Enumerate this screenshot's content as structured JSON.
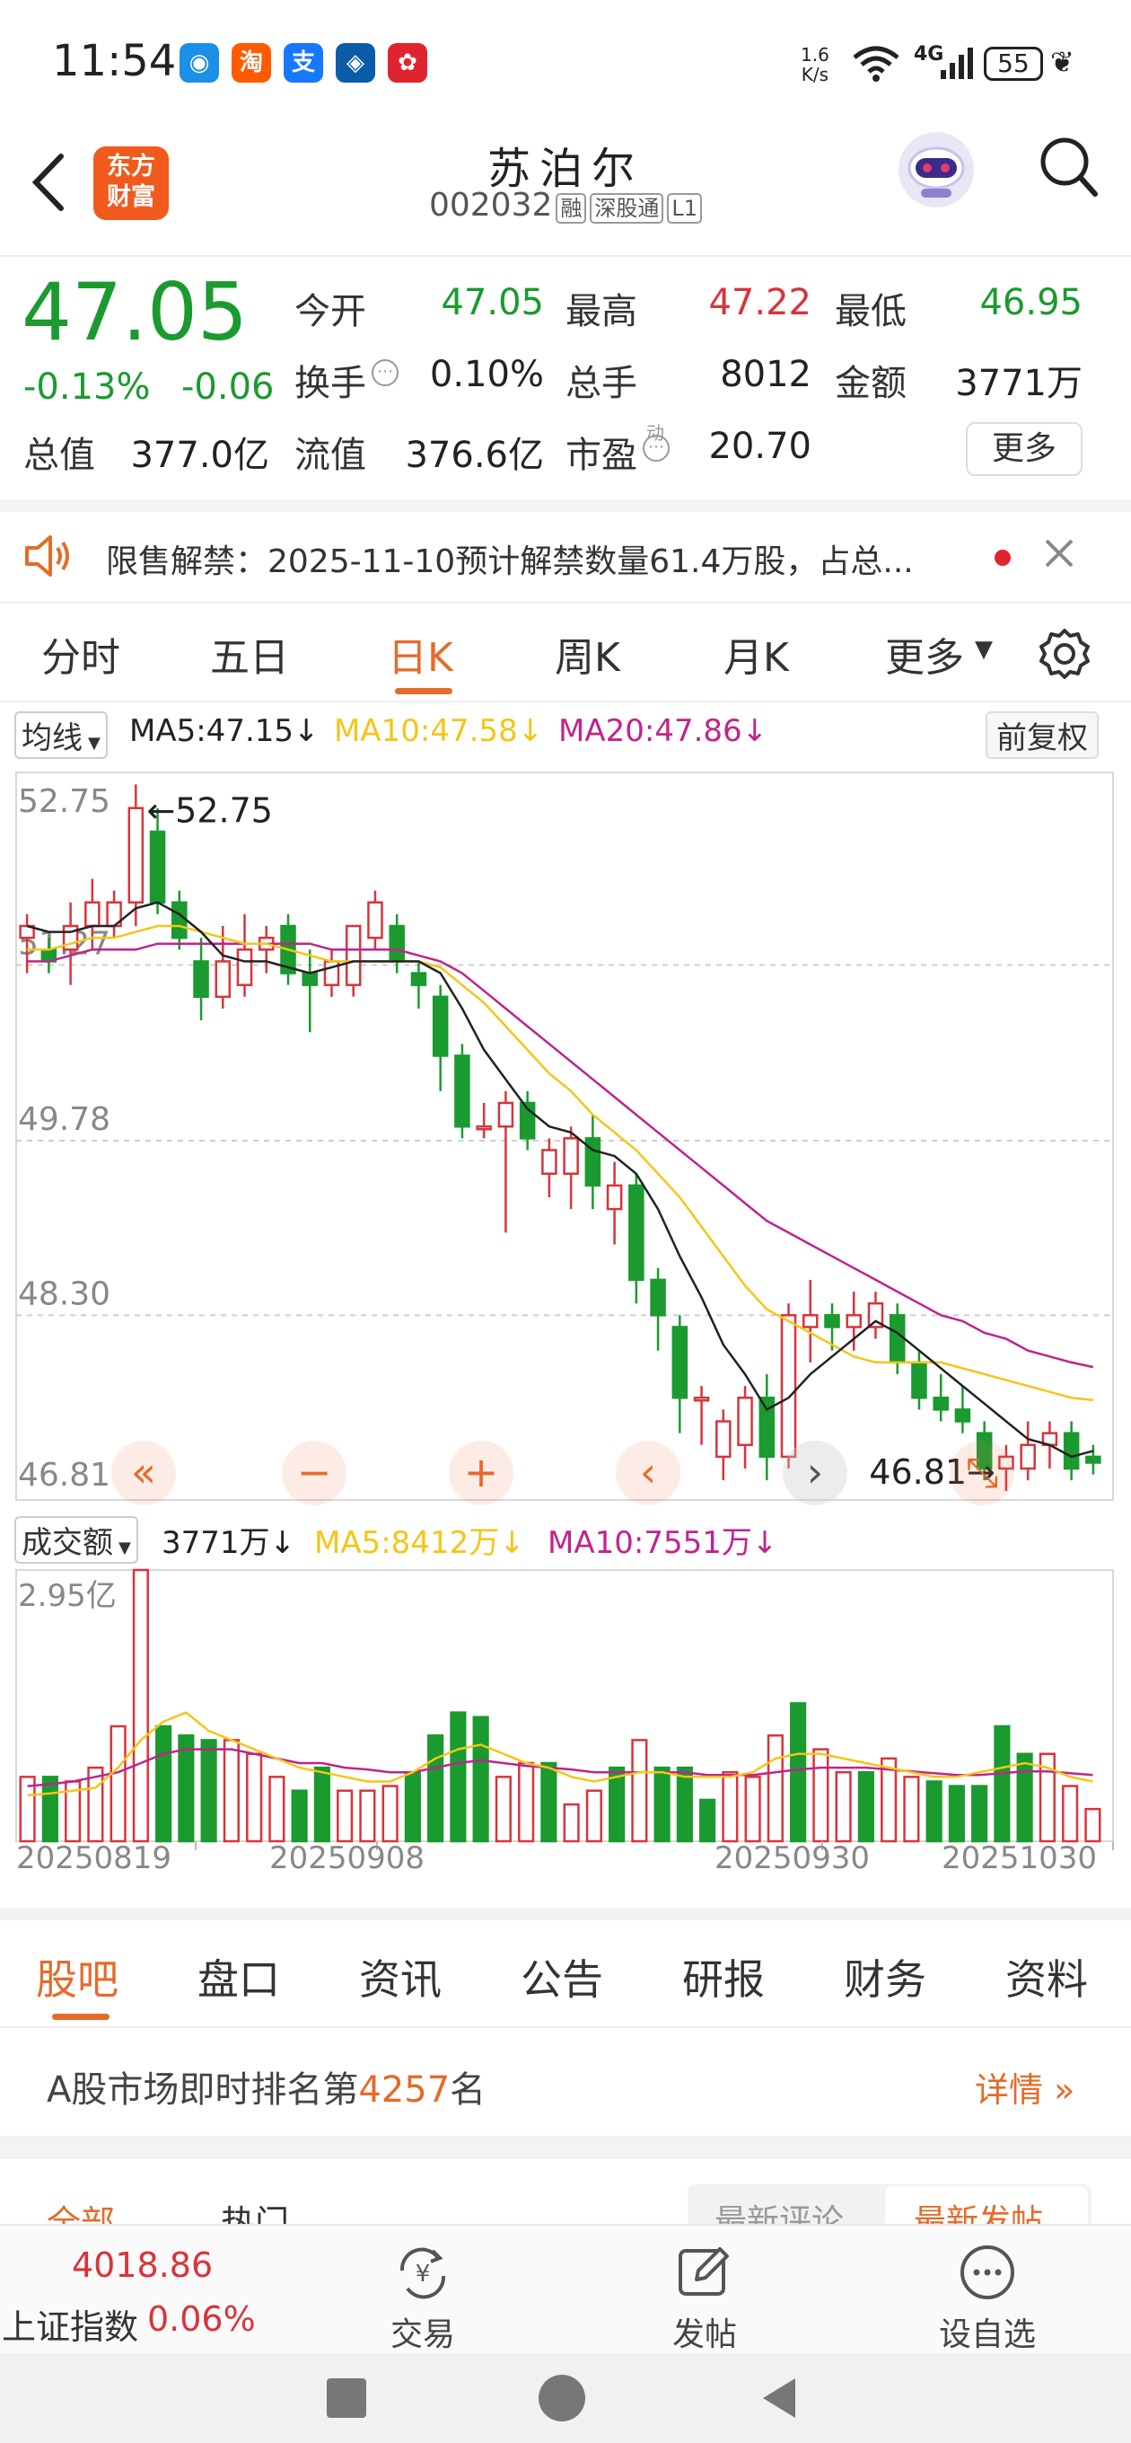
{
  "status": {
    "time": "11:54",
    "net_speed_top": "1.6",
    "net_speed_bottom": "K/s",
    "network": "4G",
    "battery": "55",
    "app_icons": [
      {
        "name": "qq-icon",
        "glyph": "◉",
        "color": "#1c8fe6"
      },
      {
        "name": "taobao-icon",
        "glyph": "淘",
        "color": "#ff5a00"
      },
      {
        "name": "alipay-icon",
        "glyph": "支",
        "color": "#1677ff"
      },
      {
        "name": "ccb-icon",
        "glyph": "◈",
        "color": "#0a5ca8"
      },
      {
        "name": "bank-icon",
        "glyph": "✿",
        "color": "#e0242f"
      }
    ]
  },
  "header": {
    "logo_line1": "东方",
    "logo_line2": "财富",
    "stock_name": "苏泊尔",
    "stock_code": "002032",
    "tags": [
      "融",
      "深股通",
      "L1"
    ]
  },
  "quote": {
    "price": "47.05",
    "change_pct": "-0.13%",
    "change": "-0.06",
    "labels": {
      "open": "今开",
      "high": "最高",
      "low": "最低",
      "turnover_rate": "换手",
      "volume": "总手",
      "amount": "金额",
      "mkt_cap": "总值",
      "float_cap": "流值",
      "pe": "市盈",
      "pe_super": "动",
      "more": "更多"
    },
    "open": "47.05",
    "high": "47.22",
    "low": "46.95",
    "turnover_rate": "0.10%",
    "volume": "8012",
    "amount": "3771万",
    "mkt_cap": "377.0亿",
    "float_cap": "376.6亿",
    "pe": "20.70"
  },
  "notice": {
    "text": "限售解禁：2025-11-10预计解禁数量61.4万股，占总..."
  },
  "period_tabs": {
    "items": [
      "分时",
      "五日",
      "日K",
      "周K",
      "月K",
      "更多"
    ],
    "active": "日K"
  },
  "chart_header": {
    "indicator": "均线",
    "ma5": "MA5:47.15",
    "ma10": "MA10:47.58",
    "ma20": "MA20:47.86",
    "adjust": "前复权",
    "arrow": "↓"
  },
  "volume_header": {
    "indicator": "成交额",
    "vol": "3771万",
    "ma5": "MA5:8412万",
    "ma10": "MA10:7551万",
    "arrow": "↓"
  },
  "colors": {
    "up": "#d8343b",
    "down": "#1a9a2f",
    "ma5": "#222222",
    "ma10": "#f5c518",
    "ma20": "#c0248b",
    "accent": "#e46b2a"
  },
  "chart_data": {
    "type": "candlestick",
    "y_ticks": [
      "52.75",
      "51.27",
      "49.78",
      "48.30",
      "46.81"
    ],
    "ylim": [
      46.81,
      52.75
    ],
    "max_label": "←52.75",
    "min_label": "46.81→",
    "x_ticks": [
      "20250819",
      "20250908",
      "20250930",
      "20251030"
    ],
    "candles": [
      [
        51.5,
        51.7,
        51.2,
        51.6
      ],
      [
        51.4,
        51.5,
        51.2,
        51.3
      ],
      [
        51.4,
        51.8,
        51.1,
        51.6
      ],
      [
        51.6,
        52.0,
        51.4,
        51.8
      ],
      [
        51.6,
        51.9,
        51.5,
        51.8
      ],
      [
        51.8,
        52.8,
        51.6,
        52.6
      ],
      [
        52.4,
        52.6,
        51.7,
        51.8
      ],
      [
        51.8,
        51.9,
        51.4,
        51.5
      ],
      [
        51.3,
        51.5,
        50.8,
        51.0
      ],
      [
        51.0,
        51.6,
        50.9,
        51.3
      ],
      [
        51.1,
        51.7,
        51.0,
        51.4
      ],
      [
        51.4,
        51.6,
        51.2,
        51.5
      ],
      [
        51.6,
        51.7,
        51.1,
        51.2
      ],
      [
        51.2,
        51.4,
        50.7,
        51.1
      ],
      [
        51.1,
        51.4,
        51.0,
        51.3
      ],
      [
        51.1,
        51.6,
        51.0,
        51.6
      ],
      [
        51.5,
        51.9,
        51.4,
        51.8
      ],
      [
        51.6,
        51.7,
        51.2,
        51.3
      ],
      [
        51.2,
        51.3,
        50.9,
        51.1
      ],
      [
        51.0,
        51.1,
        50.2,
        50.5
      ],
      [
        50.5,
        50.6,
        49.8,
        49.9
      ],
      [
        49.9,
        50.1,
        49.8,
        49.9
      ],
      [
        49.9,
        50.2,
        49.0,
        50.1
      ],
      [
        50.1,
        50.2,
        49.7,
        49.8
      ],
      [
        49.5,
        49.8,
        49.3,
        49.7
      ],
      [
        49.5,
        49.9,
        49.2,
        49.8
      ],
      [
        49.8,
        50.0,
        49.2,
        49.4
      ],
      [
        49.2,
        49.6,
        48.9,
        49.4
      ],
      [
        49.4,
        49.5,
        48.4,
        48.6
      ],
      [
        48.6,
        48.7,
        48.0,
        48.3
      ],
      [
        48.2,
        48.3,
        47.3,
        47.6
      ],
      [
        47.6,
        47.7,
        47.2,
        47.6
      ],
      [
        47.1,
        47.5,
        46.9,
        47.4
      ],
      [
        47.2,
        47.7,
        47.0,
        47.6
      ],
      [
        47.6,
        47.8,
        46.9,
        47.1
      ],
      [
        47.1,
        48.4,
        47.0,
        48.3
      ],
      [
        48.2,
        48.6,
        47.9,
        48.3
      ],
      [
        48.3,
        48.4,
        48.0,
        48.2
      ],
      [
        48.2,
        48.5,
        48.0,
        48.3
      ],
      [
        48.2,
        48.5,
        48.1,
        48.4
      ],
      [
        48.3,
        48.4,
        47.8,
        47.9
      ],
      [
        47.9,
        48.0,
        47.5,
        47.6
      ],
      [
        47.6,
        47.8,
        47.4,
        47.5
      ],
      [
        47.5,
        47.7,
        47.3,
        47.4
      ],
      [
        47.3,
        47.4,
        46.9,
        47.0
      ],
      [
        47.0,
        47.2,
        46.81,
        47.1
      ],
      [
        47.0,
        47.4,
        46.9,
        47.2
      ],
      [
        47.2,
        47.4,
        47.0,
        47.3
      ],
      [
        47.3,
        47.4,
        46.9,
        47.0
      ],
      [
        47.1,
        47.2,
        46.95,
        47.05
      ]
    ],
    "ma5": [
      51.6,
      51.55,
      51.55,
      51.6,
      51.6,
      51.75,
      51.8,
      51.7,
      51.55,
      51.35,
      51.3,
      51.3,
      51.25,
      51.2,
      51.25,
      51.3,
      51.3,
      51.3,
      51.3,
      51.2,
      50.9,
      50.55,
      50.3,
      50.05,
      49.9,
      49.85,
      49.7,
      49.65,
      49.5,
      49.2,
      48.8,
      48.45,
      48.05,
      47.8,
      47.5,
      47.6,
      47.8,
      47.95,
      48.1,
      48.25,
      48.15,
      48.0,
      47.85,
      47.7,
      47.55,
      47.4,
      47.25,
      47.2,
      47.1,
      47.15
    ],
    "ma10": [
      51.4,
      51.4,
      51.45,
      51.5,
      51.5,
      51.55,
      51.6,
      51.6,
      51.55,
      51.5,
      51.45,
      51.45,
      51.4,
      51.35,
      51.3,
      51.3,
      51.3,
      51.3,
      51.3,
      51.25,
      51.1,
      50.95,
      50.75,
      50.55,
      50.35,
      50.2,
      50.0,
      49.85,
      49.7,
      49.5,
      49.3,
      49.05,
      48.8,
      48.55,
      48.35,
      48.25,
      48.15,
      48.05,
      47.95,
      47.9,
      47.9,
      47.9,
      47.9,
      47.85,
      47.8,
      47.75,
      47.7,
      47.65,
      47.6,
      47.58
    ],
    "ma20": [
      51.3,
      51.3,
      51.35,
      51.4,
      51.4,
      51.4,
      51.45,
      51.45,
      51.45,
      51.45,
      51.45,
      51.45,
      51.45,
      51.45,
      51.4,
      51.4,
      51.4,
      51.4,
      51.35,
      51.3,
      51.2,
      51.05,
      50.9,
      50.75,
      50.6,
      50.45,
      50.3,
      50.15,
      50.0,
      49.85,
      49.7,
      49.55,
      49.4,
      49.25,
      49.1,
      49.0,
      48.9,
      48.8,
      48.7,
      48.6,
      48.5,
      48.4,
      48.3,
      48.25,
      48.15,
      48.1,
      48.0,
      47.95,
      47.9,
      47.86
    ],
    "volume_max_label": "2.95亿",
    "volume": [
      0.7,
      0.7,
      0.65,
      0.8,
      1.25,
      2.95,
      1.25,
      1.15,
      1.1,
      1.1,
      0.95,
      0.7,
      0.55,
      0.8,
      0.55,
      0.55,
      0.6,
      0.75,
      1.15,
      1.4,
      1.35,
      0.7,
      0.85,
      0.85,
      0.4,
      0.55,
      0.8,
      1.1,
      0.8,
      0.8,
      0.45,
      0.75,
      0.7,
      1.15,
      1.5,
      1.0,
      0.75,
      0.75,
      0.9,
      0.7,
      0.65,
      0.6,
      0.6,
      1.25,
      0.95,
      0.95,
      0.6,
      0.35
    ],
    "volume_ma5": [
      0.5,
      0.52,
      0.55,
      0.58,
      0.8,
      1.1,
      1.3,
      1.4,
      1.2,
      1.1,
      1.0,
      0.9,
      0.8,
      0.75,
      0.7,
      0.65,
      0.65,
      0.75,
      0.9,
      1.0,
      1.05,
      0.95,
      0.85,
      0.8,
      0.7,
      0.65,
      0.7,
      0.75,
      0.75,
      0.7,
      0.7,
      0.7,
      0.75,
      0.9,
      0.95,
      0.95,
      0.9,
      0.85,
      0.8,
      0.75,
      0.7,
      0.7,
      0.75,
      0.8,
      0.85,
      0.8,
      0.7,
      0.65
    ],
    "volume_ma10": [
      0.6,
      0.62,
      0.65,
      0.7,
      0.75,
      0.85,
      0.95,
      1.0,
      1.0,
      1.0,
      0.95,
      0.9,
      0.85,
      0.85,
      0.8,
      0.78,
      0.75,
      0.75,
      0.8,
      0.85,
      0.88,
      0.85,
      0.82,
      0.8,
      0.78,
      0.75,
      0.75,
      0.75,
      0.75,
      0.75,
      0.72,
      0.72,
      0.72,
      0.75,
      0.78,
      0.8,
      0.8,
      0.8,
      0.78,
      0.76,
      0.74,
      0.72,
      0.72,
      0.74,
      0.76,
      0.76,
      0.74,
      0.72
    ]
  },
  "section_tabs": {
    "items": [
      "股吧",
      "盘口",
      "资讯",
      "公告",
      "研报",
      "财务",
      "资料"
    ],
    "active": "股吧"
  },
  "ranking": {
    "prefix": "A股市场即时排名第",
    "rank": "4257",
    "suffix": "名",
    "detail": "详情"
  },
  "sub_tabs": {
    "left": [
      "全部",
      "热门"
    ],
    "right": [
      "最新评论",
      "最新发帖"
    ]
  },
  "bottom_bar": {
    "index_value": "4018.86",
    "index_name": "上证指数",
    "index_change": "0.06%",
    "trade": "交易",
    "post": "发帖",
    "watchlist": "设自选"
  }
}
